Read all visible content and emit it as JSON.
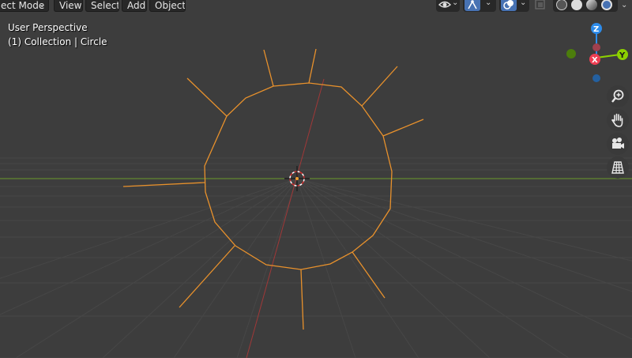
{
  "header": {
    "mode_label": "ect Mode",
    "view_label": "View",
    "select_label": "Select",
    "add_label": "Add",
    "object_label": "Object"
  },
  "overlay": {
    "perspective": "User Perspective",
    "collection": "(1) Collection | Circle"
  },
  "gizmo": {
    "z_label": "Z",
    "x_label": "X",
    "y_label": "Y"
  },
  "colors": {
    "background": "#3d3d3d",
    "grid": "#4a4a4a",
    "x_axis": "#a03838",
    "y_axis": "#6a9a2a",
    "selection": "#e8912c",
    "gizmo_x": "#ef3e53",
    "gizmo_y": "#8cd100",
    "gizmo_z": "#2d8ceb"
  },
  "icons": {
    "nav": [
      "zoom-icon",
      "hand-icon",
      "camera-icon",
      "grid-icon"
    ]
  }
}
